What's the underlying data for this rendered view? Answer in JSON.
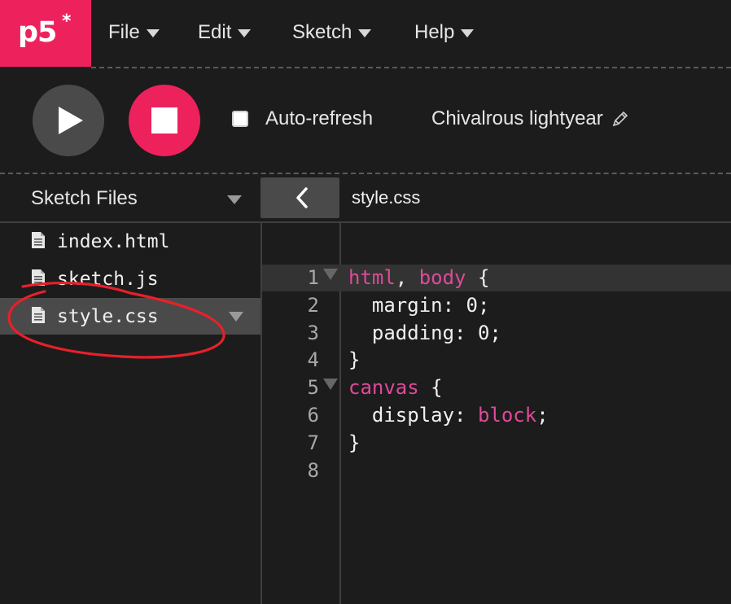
{
  "app": {
    "logo_text": "p5",
    "logo_star": "*",
    "brand_color": "#ed225d"
  },
  "menu": {
    "items": [
      {
        "label": "File"
      },
      {
        "label": "Edit"
      },
      {
        "label": "Sketch"
      },
      {
        "label": "Help"
      }
    ]
  },
  "toolbar": {
    "play_icon": "play-icon",
    "stop_icon": "stop-icon",
    "autorefresh_label": "Auto-refresh",
    "autorefresh_checked": false,
    "sketch_name": "Chivalrous lightyear",
    "edit_icon": "pencil-icon"
  },
  "sidebar": {
    "header": "Sketch Files",
    "files": [
      {
        "name": "index.html",
        "selected": false
      },
      {
        "name": "sketch.js",
        "selected": false
      },
      {
        "name": "style.css",
        "selected": true
      }
    ]
  },
  "editor": {
    "current_file": "style.css",
    "lines": [
      {
        "num": "1",
        "fold": true,
        "segments": [
          {
            "t": "html",
            "c": "pink"
          },
          {
            "t": ", ",
            "c": ""
          },
          {
            "t": "body",
            "c": "pink"
          },
          {
            "t": " {",
            "c": ""
          }
        ]
      },
      {
        "num": "2",
        "fold": false,
        "segments": [
          {
            "t": "  margin: 0;",
            "c": ""
          }
        ]
      },
      {
        "num": "3",
        "fold": false,
        "segments": [
          {
            "t": "  padding: 0;",
            "c": ""
          }
        ]
      },
      {
        "num": "4",
        "fold": false,
        "segments": [
          {
            "t": "}",
            "c": ""
          }
        ]
      },
      {
        "num": "5",
        "fold": true,
        "segments": [
          {
            "t": "canvas",
            "c": "pink"
          },
          {
            "t": " {",
            "c": ""
          }
        ]
      },
      {
        "num": "6",
        "fold": false,
        "segments": [
          {
            "t": "  display: ",
            "c": ""
          },
          {
            "t": "block",
            "c": "pink"
          },
          {
            "t": ";",
            "c": ""
          }
        ]
      },
      {
        "num": "7",
        "fold": false,
        "segments": [
          {
            "t": "}",
            "c": ""
          }
        ]
      },
      {
        "num": "8",
        "fold": false,
        "segments": []
      }
    ]
  },
  "annotation_color": "#e8202a"
}
